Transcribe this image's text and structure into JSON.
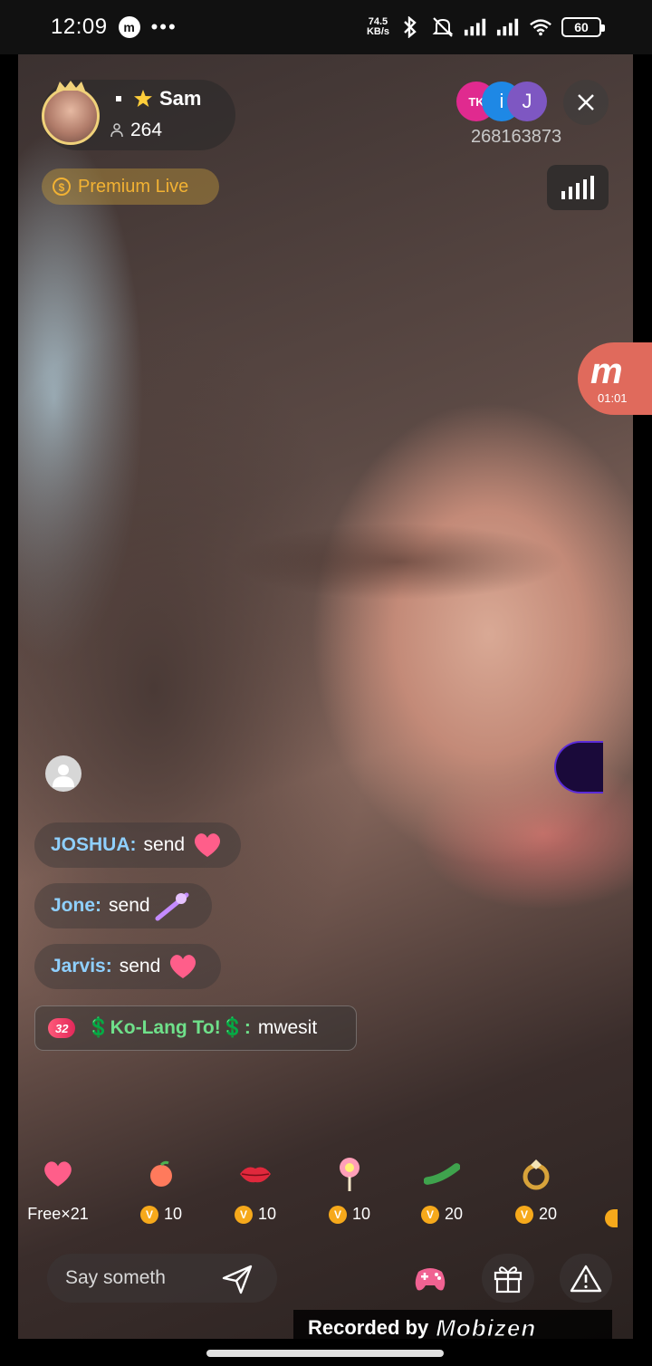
{
  "status_bar": {
    "time": "12:09",
    "app_icon": "m",
    "more": "•••",
    "net_speed_value": "74.5",
    "net_speed_unit": "KB/s",
    "battery": "60"
  },
  "host": {
    "name": "Sam",
    "follower_count": "264",
    "premium_label": "Premium Live"
  },
  "viewers": [
    "TK",
    "i",
    "J"
  ],
  "room_id": "268163873",
  "mobizen": {
    "letter": "m",
    "timer": "01:01"
  },
  "chat": [
    {
      "user": "JOSHUA:",
      "text": "send",
      "gift": "heart"
    },
    {
      "user": "Jone:",
      "text": "send",
      "gift": "wand"
    },
    {
      "user": "Jarvis:",
      "text": "send",
      "gift": "heart"
    }
  ],
  "special_message": {
    "level": "32",
    "user": "💲Ko-Lang To!💲:",
    "text": "mwesit"
  },
  "gifts": [
    {
      "icon": "heart-gift-icon",
      "label": "Free×21"
    },
    {
      "icon": "peach-gift-icon",
      "price": "10"
    },
    {
      "icon": "lips-gift-icon",
      "price": "10"
    },
    {
      "icon": "lollipop-gift-icon",
      "price": "10"
    },
    {
      "icon": "cucumber-gift-icon",
      "price": "20"
    },
    {
      "icon": "ring-gift-icon",
      "price": "20"
    }
  ],
  "input": {
    "placeholder": "Say someth"
  },
  "recorded": {
    "prefix": "Recorded by",
    "brand": "Mobizen"
  },
  "colors": {
    "premium": "#f2b233",
    "chat_user": "#8fd0ff",
    "special_user": "#6fe08a",
    "coin": "#f6a91b"
  }
}
